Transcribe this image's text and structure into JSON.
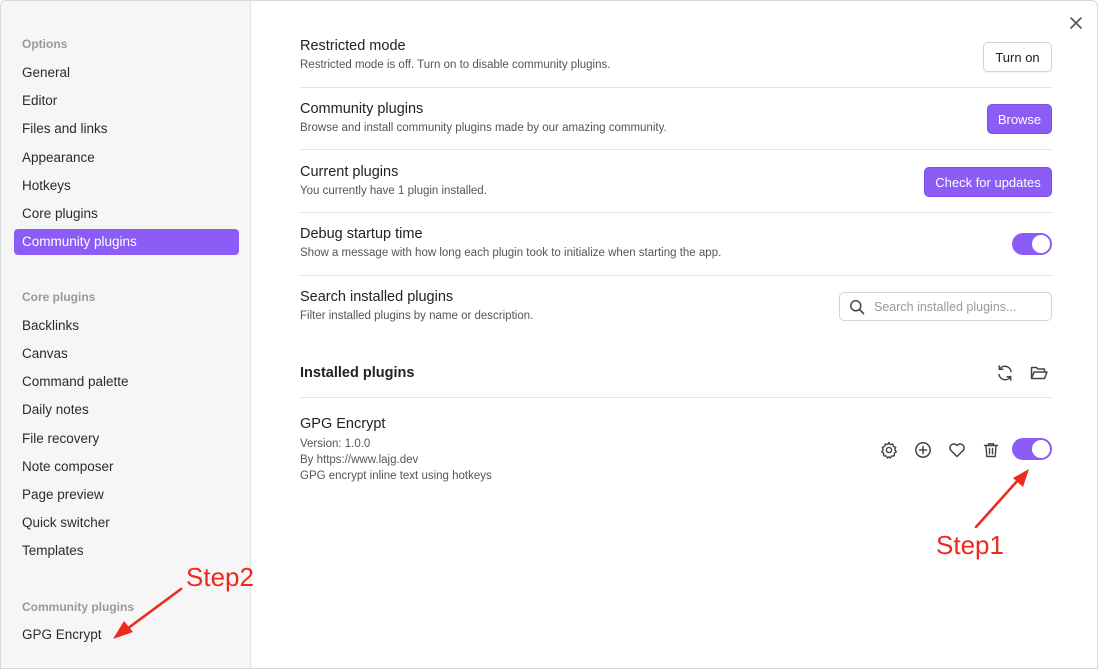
{
  "sidebar": {
    "options_heading": "Options",
    "options": [
      {
        "label": "General"
      },
      {
        "label": "Editor"
      },
      {
        "label": "Files and links"
      },
      {
        "label": "Appearance"
      },
      {
        "label": "Hotkeys"
      },
      {
        "label": "Core plugins"
      },
      {
        "label": "Community plugins",
        "active": true
      }
    ],
    "core_heading": "Core plugins",
    "core": [
      {
        "label": "Backlinks"
      },
      {
        "label": "Canvas"
      },
      {
        "label": "Command palette"
      },
      {
        "label": "Daily notes"
      },
      {
        "label": "File recovery"
      },
      {
        "label": "Note composer"
      },
      {
        "label": "Page preview"
      },
      {
        "label": "Quick switcher"
      },
      {
        "label": "Templates"
      }
    ],
    "community_heading": "Community plugins",
    "community": [
      {
        "label": "GPG Encrypt"
      }
    ]
  },
  "settings": {
    "restricted": {
      "name": "Restricted mode",
      "desc": "Restricted mode is off. Turn on to disable community plugins.",
      "button": "Turn on"
    },
    "community": {
      "name": "Community plugins",
      "desc": "Browse and install community plugins made by our amazing community.",
      "button": "Browse"
    },
    "current": {
      "name": "Current plugins",
      "desc": "You currently have 1 plugin installed.",
      "button": "Check for updates"
    },
    "debug": {
      "name": "Debug startup time",
      "desc": "Show a message with how long each plugin took to initialize when starting the app.",
      "enabled": true
    },
    "search": {
      "name": "Search installed plugins",
      "desc": "Filter installed plugins by name or description.",
      "placeholder": "Search installed plugins..."
    }
  },
  "installed": {
    "title": "Installed plugins",
    "plugins": [
      {
        "name": "GPG Encrypt",
        "version": "Version: 1.0.0",
        "author": "By https://www.lajg.dev",
        "description": "GPG encrypt inline text using hotkeys",
        "enabled": true
      }
    ]
  },
  "annotations": {
    "step1": "Step1",
    "step2": "Step2"
  },
  "colors": {
    "accent": "#8b5cf6",
    "annotation": "#ee2a1e"
  },
  "icons": [
    "close-icon",
    "search-icon",
    "reload-icon",
    "folder-open-icon",
    "gear-icon",
    "plus-circle-icon",
    "heart-icon",
    "trash-icon"
  ]
}
